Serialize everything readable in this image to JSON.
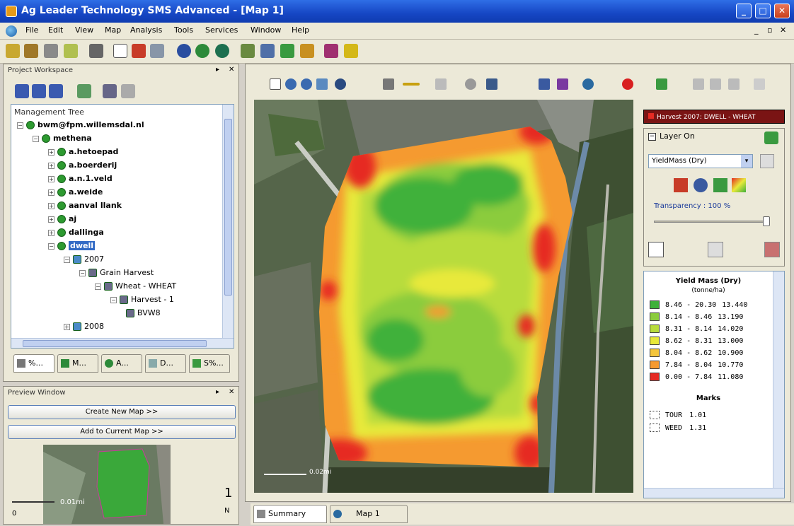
{
  "window": {
    "title": "Ag Leader Technology SMS Advanced - [Map 1]",
    "minimize": "_",
    "maximize": "□",
    "close": "✕"
  },
  "menu": {
    "items": [
      "File",
      "Edit",
      "View",
      "Map",
      "Analysis",
      "Tools",
      "Services",
      "Window",
      "Help"
    ],
    "mdi_min": "_",
    "mdi_restore": "▫",
    "mdi_close": "✕"
  },
  "project_workspace": {
    "title": "Project Workspace",
    "tree_title": "Management Tree",
    "tree": [
      {
        "label": "bwm@fpm.willemsdal.nl",
        "level": 0,
        "expander": "−"
      },
      {
        "label": "methena",
        "level": 1,
        "expander": "−"
      },
      {
        "label": "a.hetoepad",
        "level": 2,
        "expander": "+"
      },
      {
        "label": "a.boerderij",
        "level": 2,
        "expander": "+"
      },
      {
        "label": "a.n.1.veld",
        "level": 2,
        "expander": "+"
      },
      {
        "label": "a.weide",
        "level": 2,
        "expander": "+"
      },
      {
        "label": "aanval llank",
        "level": 2,
        "expander": "+"
      },
      {
        "label": "aj",
        "level": 2,
        "expander": "+"
      },
      {
        "label": "dallinga",
        "level": 2,
        "expander": "+"
      },
      {
        "label": "dwell",
        "level": 2,
        "expander": "−",
        "selected": true
      },
      {
        "label": "2007",
        "level": 3,
        "expander": "−"
      },
      {
        "label": "Grain Harvest",
        "level": 4,
        "expander": "−"
      },
      {
        "label": "Wheat - WHEAT",
        "level": 5,
        "expander": "−"
      },
      {
        "label": "Harvest - 1",
        "level": 6,
        "expander": "−"
      },
      {
        "label": "BVW8",
        "level": 7,
        "expander": ""
      },
      {
        "label": "2008",
        "level": 3,
        "expander": "+"
      }
    ],
    "tabs": [
      "%...",
      "M...",
      "A...",
      "D...",
      "S%..."
    ]
  },
  "preview": {
    "title": "Preview Window",
    "create_button": "Create New Map >>",
    "add_button": "Add to Current Map >>",
    "scale_label": "0.01mi",
    "scale_left": "0",
    "scale_right": "1",
    "scale_sub": "N"
  },
  "map": {
    "status_tabs": [
      "Summary",
      "Map 1"
    ],
    "scale_text": "0.02mi"
  },
  "legend_panel": {
    "header": "Harvest 2007: DWELL - WHEAT",
    "layer_label": "Layer On",
    "layer_select": "YieldMass (Dry)",
    "transparency": "Transparency : 100 %",
    "transparency_pct": 100,
    "legend_title": "Yield Mass (Dry)",
    "legend_unit": "(tonne/ha)",
    "rows": [
      {
        "range": "8.46 - 20.30",
        "value": "13.440",
        "color": "#3fb13a"
      },
      {
        "range": "8.14 - 8.46",
        "value": "13.190",
        "color": "#8bcc3c"
      },
      {
        "range": "8.31 - 8.14",
        "value": "14.020",
        "color": "#b8dc3c"
      },
      {
        "range": "8.62 - 8.31",
        "value": "13.000",
        "color": "#e8e93a"
      },
      {
        "range": "8.04 - 8.62",
        "value": "10.900",
        "color": "#f4c53a"
      },
      {
        "range": "7.84 - 8.04",
        "value": "10.770",
        "color": "#f59a30"
      },
      {
        "range": "0.00 - 7.84",
        "value": "11.080",
        "color": "#e62b24"
      }
    ],
    "marks_title": "Marks",
    "marks": [
      {
        "code": "TOUR",
        "value": "1.01"
      },
      {
        "code": "WEED",
        "value": "1.31"
      }
    ]
  },
  "colors": {
    "title_bar": "#1d53d3",
    "chrome": "#ece9d8",
    "selection": "#316ac5",
    "low_yield": "#e62b24",
    "high_yield": "#3fb13a"
  }
}
